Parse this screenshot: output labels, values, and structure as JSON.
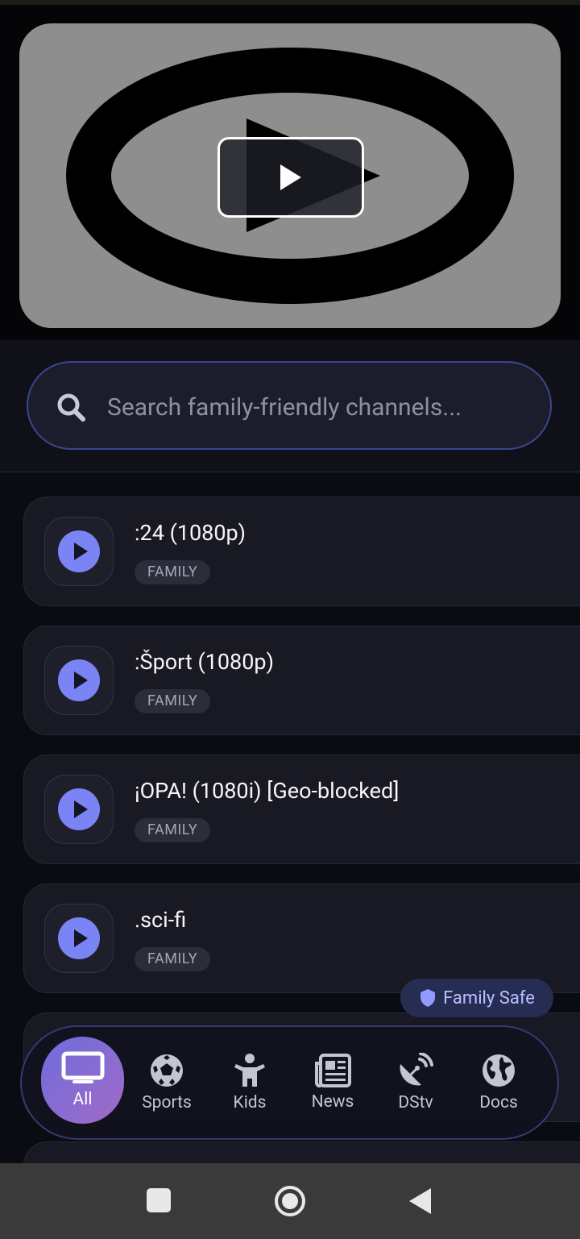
{
  "player": {
    "play_label": "play"
  },
  "search": {
    "placeholder": "Search family-friendly channels..."
  },
  "channels": [
    {
      "title": ":24 (1080p)",
      "tag": "FAMILY"
    },
    {
      "title": ":Šport (1080p)",
      "tag": "FAMILY"
    },
    {
      "title": "¡OPA! (1080i) [Geo-blocked]",
      "tag": "FAMILY"
    },
    {
      "title": ".sci-fi",
      "tag": "FAMILY"
    }
  ],
  "badge": {
    "label": "Family Safe"
  },
  "nav": {
    "items": [
      {
        "label": "All",
        "icon": "tv-icon",
        "active": true
      },
      {
        "label": "Sports",
        "icon": "soccer-ball-icon"
      },
      {
        "label": "Kids",
        "icon": "child-icon"
      },
      {
        "label": "News",
        "icon": "newspaper-icon"
      },
      {
        "label": "DStv",
        "icon": "satellite-dish-icon"
      },
      {
        "label": "Docs",
        "icon": "globe-icon"
      }
    ]
  },
  "colors": {
    "accent": "#7b84f5",
    "nav_active": "#8f6ad0",
    "background": "#0b0b12"
  }
}
